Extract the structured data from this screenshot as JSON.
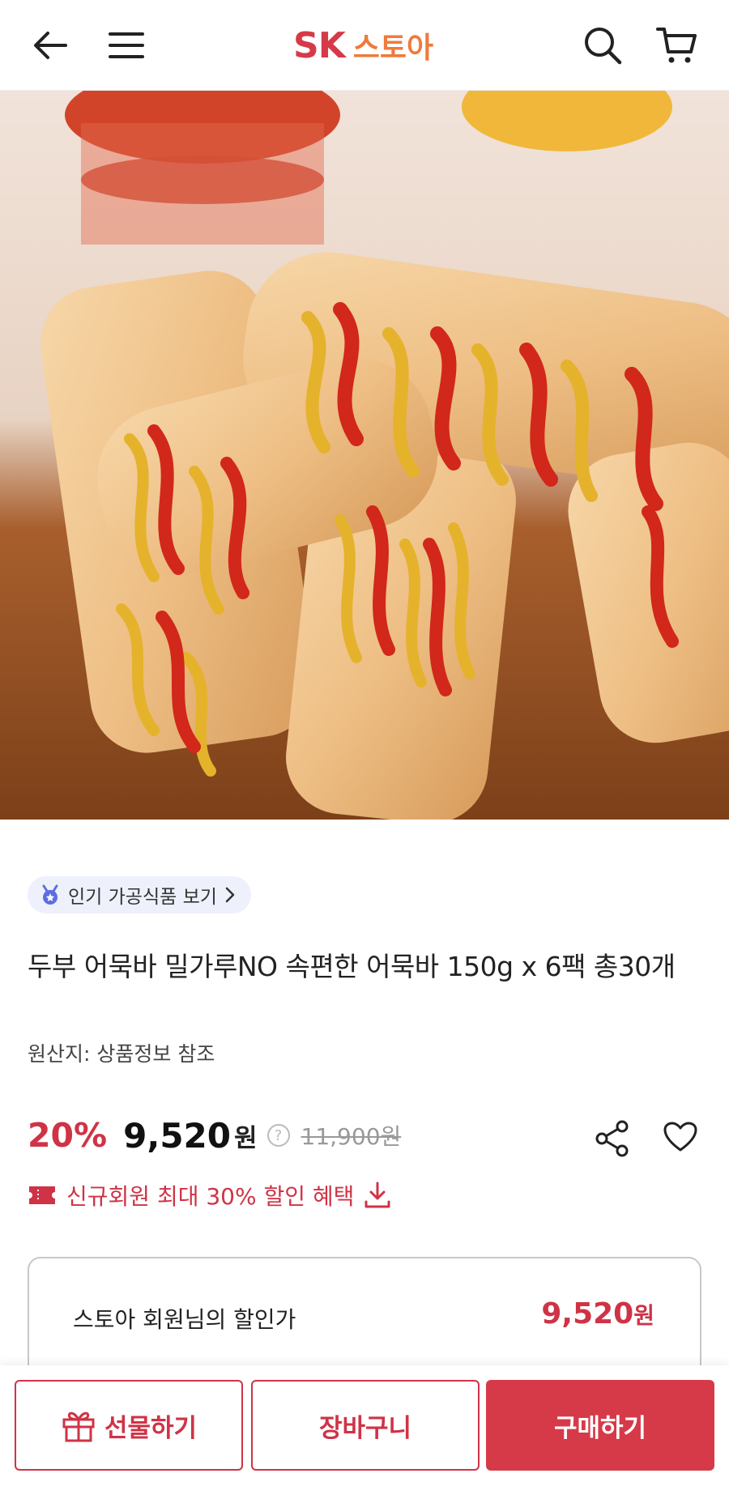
{
  "colors": {
    "brand_red": "#d63a49",
    "brand_orange": "#f07a3c",
    "accent": "#cf3346",
    "muted": "#999999",
    "chip_icon": "#5b6ee1"
  },
  "header": {
    "back_icon": "arrow-left-icon",
    "menu_icon": "hamburger-menu-icon",
    "logo_sk": "SK",
    "logo_store": "스토아",
    "search_icon": "search-icon",
    "cart_icon": "cart-icon"
  },
  "product": {
    "chip_label": "인기 가공식품 보기",
    "title": "두부 어묵바 밀가루NO 속편한 어묵바 150g x 6팩 총30개",
    "origin": "원산지: 상품정보 참조",
    "discount": "20%",
    "price": "9,520",
    "price_unit": "원",
    "help_mark": "?",
    "original_price": "11,900원",
    "benefit_text": "신규회원 최대 30% 할인 혜택"
  },
  "member": {
    "label": "스토아 회원님의 할인가",
    "price": "9,520",
    "unit": "원"
  },
  "bottom_bar": {
    "gift_label": "선물하기",
    "cart_label": "장바구니",
    "buy_label": "구매하기"
  }
}
